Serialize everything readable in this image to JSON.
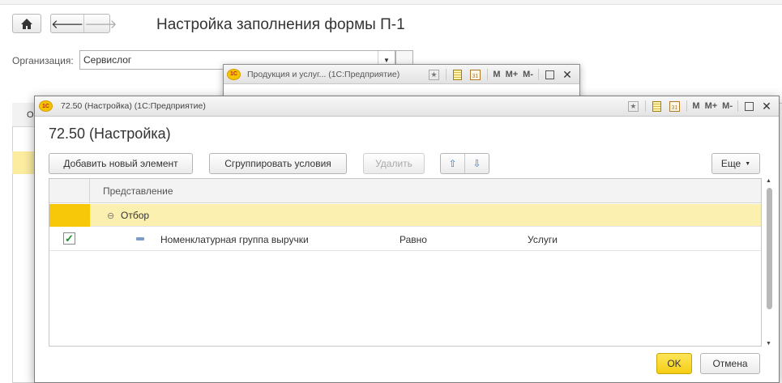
{
  "background": {
    "title": "Настройка заполнения формы П-1",
    "org_label": "Организация:",
    "org_value": "Сервислог",
    "table_col_letter": "О"
  },
  "middle_window": {
    "title": "Продукция и услуг...  (1С:Предприятие)"
  },
  "dialog": {
    "window_title": "72.50 (Настройка)  (1С:Предприятие)",
    "heading": "72.50 (Настройка)",
    "toolbar": {
      "add_label": "Добавить новый элемент",
      "group_label": "Сгруппировать условия",
      "delete_label": "Удалить",
      "more_label": "Еще"
    },
    "grid": {
      "column_header": "Представление",
      "group_row": {
        "label": "Отбор"
      },
      "rows": [
        {
          "checked": true,
          "field": "Номенклатурная группа выручки",
          "comparison": "Равно",
          "value": "Услуги"
        }
      ]
    },
    "ok_label": "OK",
    "cancel_label": "Отмена"
  },
  "titlebar_icons": [
    "star-icon",
    "book-icon",
    "calendar-icon",
    "memory-icon",
    "memory-plus-icon",
    "memory-minus-icon",
    "maximize-icon",
    "close-icon"
  ],
  "titlebar_text": {
    "m": "M",
    "mplus": "M+",
    "mminus": "M-",
    "cal": "31"
  },
  "colors": {
    "accent_yellow": "#f7c80a",
    "selected_row": "#fbf0b0",
    "ok_button": "#f4ce14"
  }
}
